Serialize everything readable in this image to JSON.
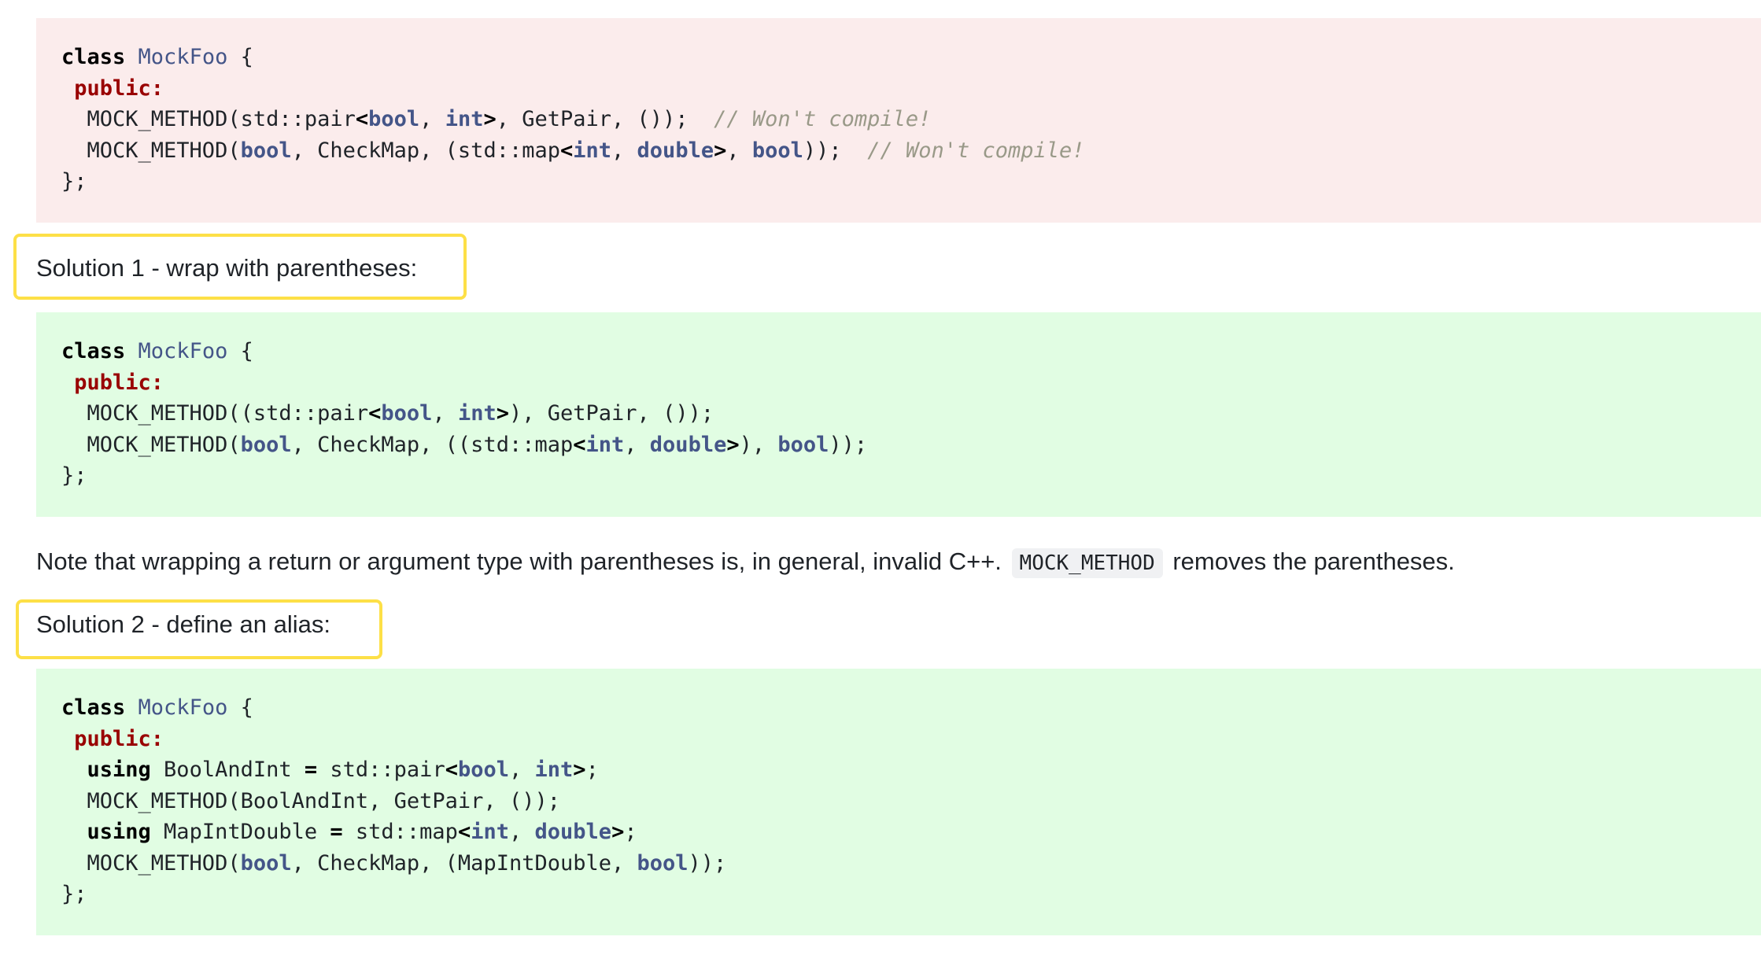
{
  "code_block_1": {
    "lines": [
      [
        {
          "c": "k",
          "t": "class"
        },
        {
          "c": "",
          "t": " "
        },
        {
          "c": "t",
          "t": "MockFoo"
        },
        {
          "c": "",
          "t": " {"
        }
      ],
      [
        {
          "c": "",
          "t": " "
        },
        {
          "c": "acc",
          "t": "public:"
        }
      ],
      [
        {
          "c": "",
          "t": "  MOCK_METHOD(std::pair"
        },
        {
          "c": "k",
          "t": "<"
        },
        {
          "c": "bt",
          "t": "bool"
        },
        {
          "c": "",
          "t": ", "
        },
        {
          "c": "bt",
          "t": "int"
        },
        {
          "c": "k",
          "t": ">"
        },
        {
          "c": "",
          "t": ", GetPair, ());  "
        },
        {
          "c": "cm",
          "t": "// Won't compile!"
        }
      ],
      [
        {
          "c": "",
          "t": "  MOCK_METHOD("
        },
        {
          "c": "bt",
          "t": "bool"
        },
        {
          "c": "",
          "t": ", CheckMap, (std::map"
        },
        {
          "c": "k",
          "t": "<"
        },
        {
          "c": "bt",
          "t": "int"
        },
        {
          "c": "",
          "t": ", "
        },
        {
          "c": "bt",
          "t": "double"
        },
        {
          "c": "k",
          "t": ">"
        },
        {
          "c": "",
          "t": ", "
        },
        {
          "c": "bt",
          "t": "bool"
        },
        {
          "c": "",
          "t": "));  "
        },
        {
          "c": "cm",
          "t": "// Won't compile!"
        }
      ],
      [
        {
          "c": "",
          "t": "};"
        }
      ]
    ]
  },
  "solution1_label": "Solution 1 - wrap with parentheses:",
  "code_block_2": {
    "lines": [
      [
        {
          "c": "k",
          "t": "class"
        },
        {
          "c": "",
          "t": " "
        },
        {
          "c": "t",
          "t": "MockFoo"
        },
        {
          "c": "",
          "t": " {"
        }
      ],
      [
        {
          "c": "",
          "t": " "
        },
        {
          "c": "acc",
          "t": "public:"
        }
      ],
      [
        {
          "c": "",
          "t": "  MOCK_METHOD((std::pair"
        },
        {
          "c": "k",
          "t": "<"
        },
        {
          "c": "bt",
          "t": "bool"
        },
        {
          "c": "",
          "t": ", "
        },
        {
          "c": "bt",
          "t": "int"
        },
        {
          "c": "k",
          "t": ">"
        },
        {
          "c": "",
          "t": "), GetPair, ());"
        }
      ],
      [
        {
          "c": "",
          "t": "  MOCK_METHOD("
        },
        {
          "c": "bt",
          "t": "bool"
        },
        {
          "c": "",
          "t": ", CheckMap, ((std::map"
        },
        {
          "c": "k",
          "t": "<"
        },
        {
          "c": "bt",
          "t": "int"
        },
        {
          "c": "",
          "t": ", "
        },
        {
          "c": "bt",
          "t": "double"
        },
        {
          "c": "k",
          "t": ">"
        },
        {
          "c": "",
          "t": "), "
        },
        {
          "c": "bt",
          "t": "bool"
        },
        {
          "c": "",
          "t": "));"
        }
      ],
      [
        {
          "c": "",
          "t": "};"
        }
      ]
    ]
  },
  "note": {
    "before": "Note that wrapping a return or argument type with parentheses is, in general, invalid C++.",
    "code": "MOCK_METHOD",
    "after": "removes the parentheses."
  },
  "solution2_label": "Solution 2 - define an alias:",
  "code_block_3": {
    "lines": [
      [
        {
          "c": "k",
          "t": "class"
        },
        {
          "c": "",
          "t": " "
        },
        {
          "c": "t",
          "t": "MockFoo"
        },
        {
          "c": "",
          "t": " {"
        }
      ],
      [
        {
          "c": "",
          "t": " "
        },
        {
          "c": "acc",
          "t": "public:"
        }
      ],
      [
        {
          "c": "",
          "t": "  "
        },
        {
          "c": "k",
          "t": "using"
        },
        {
          "c": "",
          "t": " BoolAndInt "
        },
        {
          "c": "k",
          "t": "="
        },
        {
          "c": "",
          "t": " std::pair"
        },
        {
          "c": "k",
          "t": "<"
        },
        {
          "c": "bt",
          "t": "bool"
        },
        {
          "c": "",
          "t": ", "
        },
        {
          "c": "bt",
          "t": "int"
        },
        {
          "c": "k",
          "t": ">"
        },
        {
          "c": "",
          "t": ";"
        }
      ],
      [
        {
          "c": "",
          "t": "  MOCK_METHOD(BoolAndInt, GetPair, ());"
        }
      ],
      [
        {
          "c": "",
          "t": "  "
        },
        {
          "c": "k",
          "t": "using"
        },
        {
          "c": "",
          "t": " MapIntDouble "
        },
        {
          "c": "k",
          "t": "="
        },
        {
          "c": "",
          "t": " std::map"
        },
        {
          "c": "k",
          "t": "<"
        },
        {
          "c": "bt",
          "t": "int"
        },
        {
          "c": "",
          "t": ", "
        },
        {
          "c": "bt",
          "t": "double"
        },
        {
          "c": "k",
          "t": ">"
        },
        {
          "c": "",
          "t": ";"
        }
      ],
      [
        {
          "c": "",
          "t": "  MOCK_METHOD("
        },
        {
          "c": "bt",
          "t": "bool"
        },
        {
          "c": "",
          "t": ", CheckMap, (MapIntDouble, "
        },
        {
          "c": "bt",
          "t": "bool"
        },
        {
          "c": "",
          "t": "));"
        }
      ],
      [
        {
          "c": "",
          "t": "};"
        }
      ]
    ]
  },
  "colors": {
    "error_block_bg": "#fbecec",
    "ok_block_bg": "#e1fde3",
    "highlight_border": "#fde047",
    "type_color": "#445588",
    "access_color": "#990000",
    "comment_color": "#999988"
  }
}
